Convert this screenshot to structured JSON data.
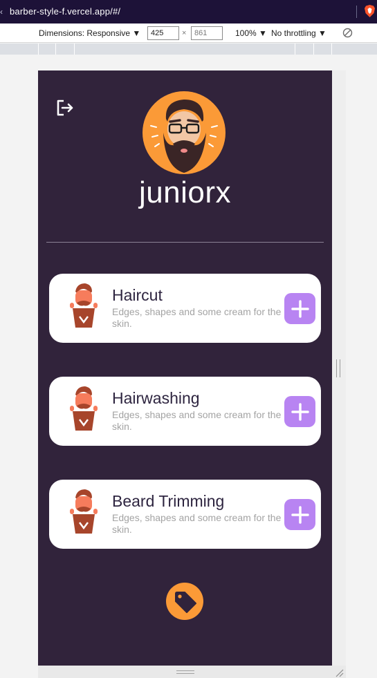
{
  "browser": {
    "url": "barber-style-f.vercel.app/#/"
  },
  "devtools": {
    "dimensions_label": "Dimensions: Responsive",
    "width_value": "425",
    "height_value": "861",
    "times": "×",
    "zoom_label": "100%",
    "throttling_label": "No throttling",
    "dropdown_glyph": "▼"
  },
  "app": {
    "username": "juniorx",
    "icons": {
      "logout": "logout-icon",
      "avatar": "bearded-man-avatar",
      "tag": "tag-icon",
      "add": "plus-icon"
    },
    "colors": {
      "background": "#31233b",
      "accent_orange": "#fb9a37",
      "accent_purple": "#b884f2",
      "card": "#ffffff",
      "title_text": "#2e2540",
      "desc_text": "#a3a3a3"
    },
    "services": [
      {
        "title": "Haircut",
        "description": "Edges, shapes and some cream for the skin."
      },
      {
        "title": "Hairwashing",
        "description": "Edges, shapes and some cream for the skin."
      },
      {
        "title": "Beard Trimming",
        "description": "Edges, shapes and some cream for the skin."
      }
    ]
  }
}
